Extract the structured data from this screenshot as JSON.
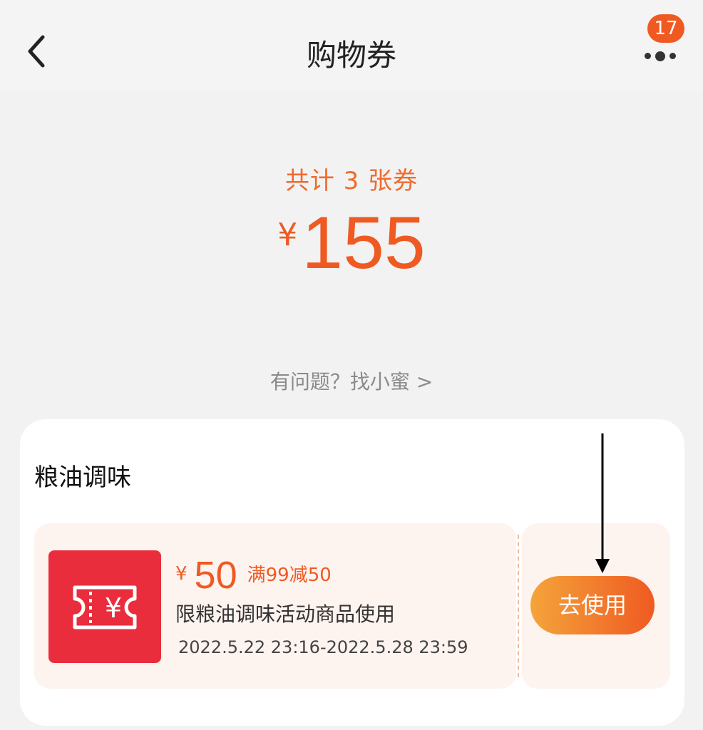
{
  "header": {
    "title": "购物券",
    "badge_count": "17"
  },
  "summary": {
    "count_text": "共计 3 张券",
    "currency": "¥",
    "total": "155"
  },
  "help_link": "有问题？找小蜜 >",
  "category": {
    "title": "粮油调味",
    "coupon": {
      "currency": "¥",
      "amount": "50",
      "condition": "满99减50",
      "description": "限粮油调味活动商品使用",
      "validity": "2022.5.22 23:16-2022.5.28 23:59",
      "use_button": "去使用"
    }
  },
  "colors": {
    "accent": "#ef5a23",
    "coupon_icon_bg": "#e92d3c",
    "coupon_bg": "#fdf3ef"
  },
  "icons": [
    "back-arrow-icon",
    "more-dots-icon",
    "ticket-yen-icon",
    "down-arrow-indicator"
  ]
}
